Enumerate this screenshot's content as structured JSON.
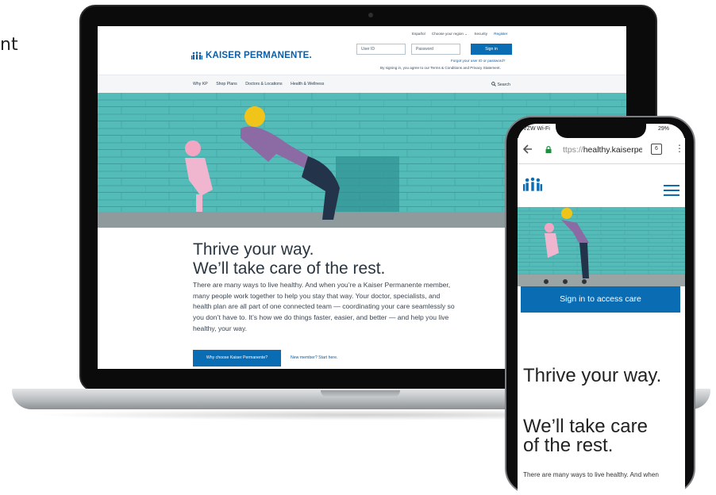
{
  "left_edge_fragment": "nt",
  "desktop": {
    "top_links": [
      "Español",
      "Choose your region ⌄",
      "Security"
    ],
    "register_link": "Register",
    "brand_name": "KAISER PERMANENTE.",
    "userid_placeholder": "User ID",
    "password_placeholder": "Password",
    "signin_label": "Sign in",
    "forgot_text": "Forgot your user ID or password?",
    "agreement_text": "By signing in, you agree to our Terms & Conditions and Privacy Statement.",
    "nav_items": [
      "Why KP",
      "Shop Plans",
      "Doctors & Locations",
      "Health & Wellness"
    ],
    "search_label": "Search",
    "headline_1": "Thrive your way.",
    "headline_2": "We’ll take care of the rest.",
    "body_lines": [
      "There are many ways to live healthy. And when you’re a Kaiser Permanente member,",
      "many people work together to help you stay that way. Your doctor, specialists, and",
      "health plan are all part of one connected team — coordinating your care seamlessly so",
      "you don’t have to. It’s how we do things faster, easier, and better — and help you live",
      "healthy, your way."
    ],
    "cta_label": "Why choose Kaiser Permanente?",
    "new_member_link": "New member? Start here."
  },
  "mobile": {
    "carrier": "VZW Wi-Fi",
    "battery": "29%",
    "url_prefix": "ttps://",
    "url_host": "healthy.kaiserper",
    "tab_count": "6",
    "signin_banner": "Sign in to access care",
    "headline_1": "Thrive your way.",
    "headline_2_line1": "We’ll take care",
    "headline_2_line2": "of the rest.",
    "body_start": "There are many ways to live healthy. And when"
  },
  "colors": {
    "brand_blue": "#0a6cb3",
    "hero_teal": "#4fb8b4"
  },
  "icons": [
    "lock-icon",
    "back-arrow-icon",
    "kebab-menu-icon",
    "hamburger-menu-icon",
    "kp-logo-icon",
    "search-icon"
  ]
}
